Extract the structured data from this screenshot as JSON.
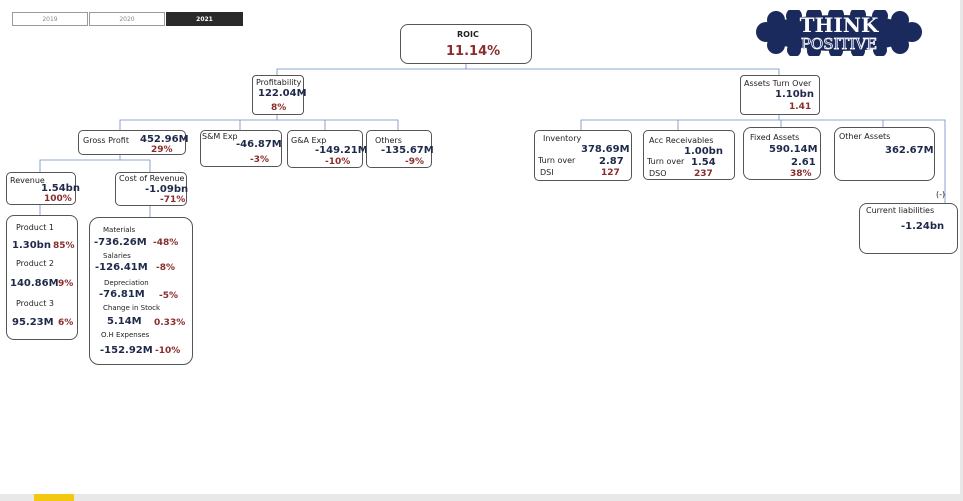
{
  "years": [
    "2019",
    "2020",
    "2021"
  ],
  "logo": {
    "line1": "THINK",
    "line2": "POSITIVE",
    "cloud_color": "#1b2a5c"
  },
  "roic": {
    "label": "ROIC",
    "value": "11.14%"
  },
  "profitability": {
    "label": "Profitability",
    "value": "122.04M",
    "pct": "8%"
  },
  "assets_turn_over": {
    "label": "Assets Turn Over",
    "value": "1.10bn",
    "ratio": "1.41"
  },
  "gross_profit": {
    "label": "Gross Profit",
    "value": "452.96M",
    "pct": "29%"
  },
  "sm_exp": {
    "label": "S&M Exp",
    "value": "-46.87M",
    "pct": "-3%"
  },
  "ga_exp": {
    "label": "G&A Exp",
    "value": "-149.21M",
    "pct": "-10%"
  },
  "others": {
    "label": "Others",
    "value": "-135.67M",
    "pct": "-9%"
  },
  "revenue": {
    "label": "Revenue",
    "value": "1.54bn",
    "pct": "100%"
  },
  "cost_of_revenue": {
    "label": "Cost of Revenue",
    "value": "-1.09bn",
    "pct": "-71%"
  },
  "products": [
    {
      "label": "Product 1",
      "value": "1.30bn",
      "pct": "85%"
    },
    {
      "label": "Product 2",
      "value": "140.86M",
      "pct": "9%"
    },
    {
      "label": "Product 3",
      "value": "95.23M",
      "pct": "6%"
    }
  ],
  "costs": [
    {
      "label": "Materials",
      "value": "-736.26M",
      "pct": "-48%"
    },
    {
      "label": "Salaries",
      "value": "-126.41M",
      "pct": "-8%"
    },
    {
      "label": "Depreciation",
      "value": "-76.81M",
      "pct": "-5%"
    },
    {
      "label": "Change in Stock",
      "value": "5.14M",
      "pct": "0.33%"
    },
    {
      "label": "O.H Expenses",
      "value": "-152.92M",
      "pct": "-10%"
    }
  ],
  "inventory": {
    "label": "Inventory",
    "value": "378.69M",
    "turn_label": "Turn over",
    "turn": "2.87",
    "dsi_label": "DSI",
    "dsi": "127"
  },
  "acc_receivables": {
    "label": "Acc Receivables",
    "value": "1.00bn",
    "turn_label": "Turn over",
    "turn": "1.54",
    "dso_label": "DSO",
    "dso": "237"
  },
  "fixed_assets": {
    "label": "Fixed Assets",
    "value": "590.14M",
    "ratio": "2.61",
    "pct": "38%"
  },
  "other_assets": {
    "label": "Other Assets",
    "value": "362.67M"
  },
  "current_liabilities": {
    "sign": "(-)",
    "label": "Current liabilities",
    "value": "-1.24bn"
  },
  "line_color": "#6b8cc2"
}
